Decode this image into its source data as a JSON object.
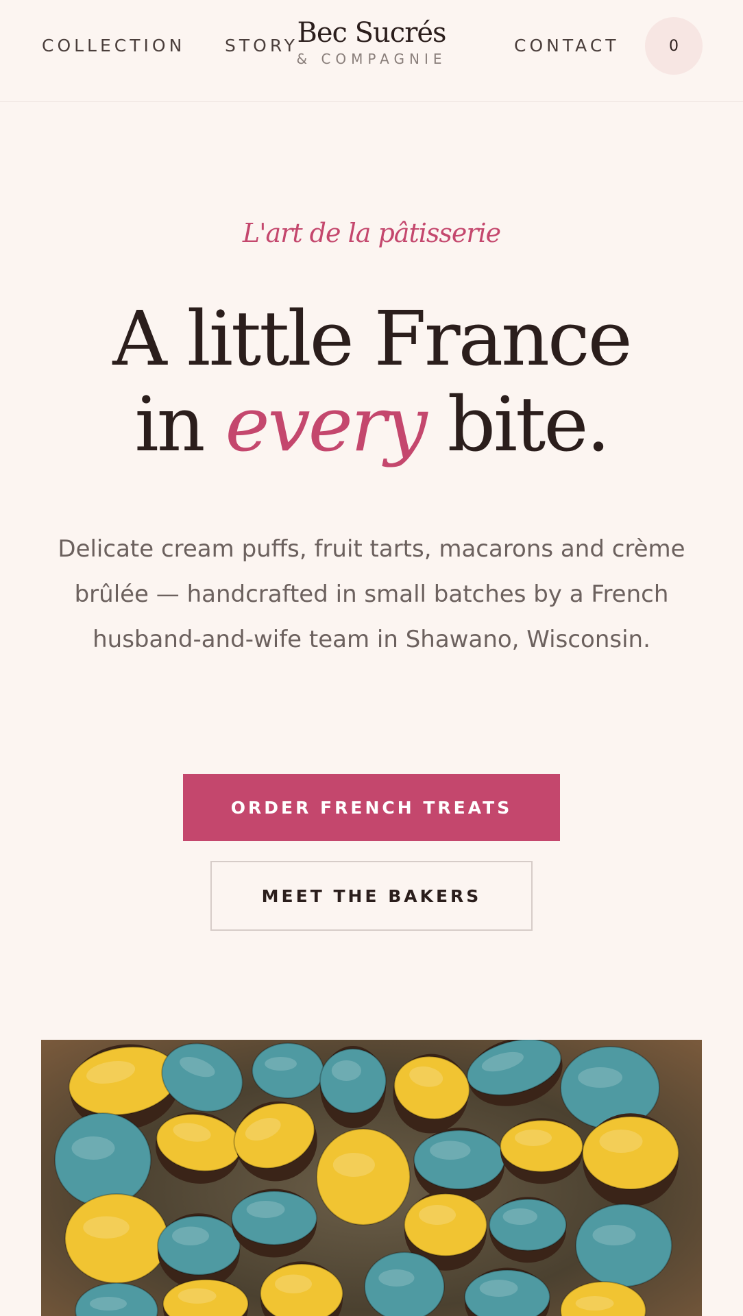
{
  "header": {
    "nav": {
      "collection": "COLLECTION",
      "story": "STORY",
      "contact": "CONTACT"
    },
    "logo": {
      "title": "Bec Sucrés",
      "subtitle": "& COMPAGNIE"
    },
    "cart_count": "0"
  },
  "hero": {
    "eyebrow": "L'art de la pâtisserie",
    "headline_line1": "A little France",
    "headline_in": "in",
    "headline_accent": "every",
    "headline_end": "bite.",
    "description": "Delicate cream puffs, fruit tarts, macarons and crème brûlée — handcrafted in small batches by a French husband-and-wife team in Shawano, Wisconsin.",
    "primary_cta": "ORDER FRENCH TREATS",
    "secondary_cta": "MEET THE BAKERS"
  },
  "photo": {
    "subject": "macarons-photo"
  },
  "colors": {
    "background": "#fcf5f1",
    "accent": "#c4476d",
    "text": "#2b1e1c",
    "muted": "#6c615e",
    "macaron_yellow": "#f1c432",
    "macaron_teal": "#4f9aa2",
    "ganache": "#3a2418"
  }
}
